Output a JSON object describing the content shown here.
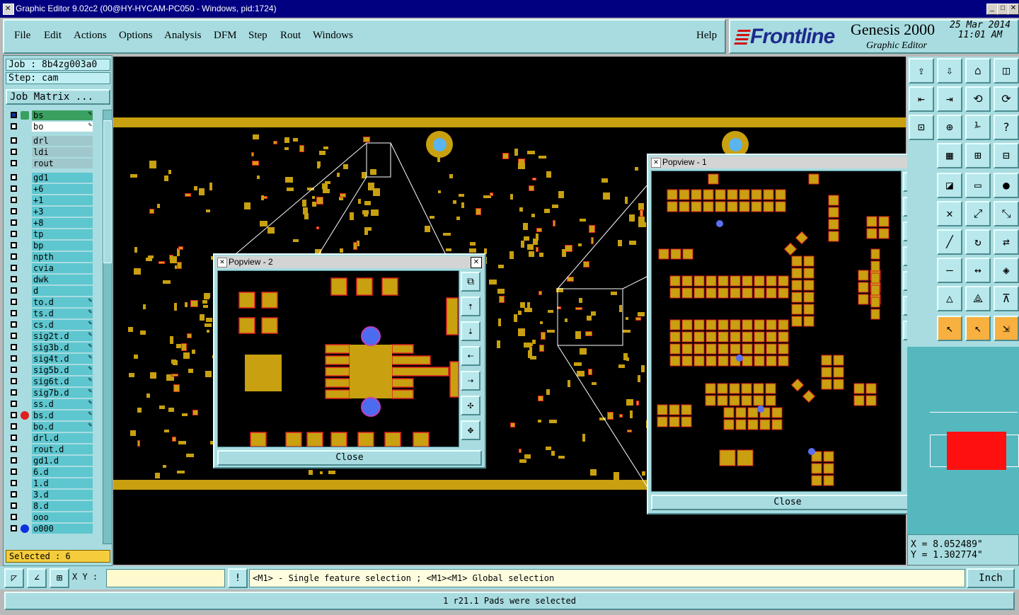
{
  "window": {
    "title": "Graphic Editor 9.02c2 (00@HY-HYCAM-PC050 - Windows, pid:1724)",
    "minimize": "_",
    "maximize": "□",
    "close": "✕"
  },
  "menu": {
    "items": [
      "File",
      "Edit",
      "Actions",
      "Options",
      "Analysis",
      "DFM",
      "Step",
      "Rout",
      "Windows"
    ],
    "help": "Help"
  },
  "brand": {
    "logo": "Frontline",
    "product": "Genesis 2000",
    "subtitle": "Graphic Editor",
    "date": "25 Mar 2014",
    "time": "11:01 AM"
  },
  "left": {
    "job": "Job : 8b4zg003a0",
    "step": "Step: cam",
    "job_matrix": "Job Matrix ...",
    "selected": "Selected : 6",
    "layers": [
      {
        "name": "bs",
        "style": "green",
        "dot": "icon",
        "pen": true
      },
      {
        "name": "bo",
        "style": "white",
        "dot": "",
        "pen": true
      },
      {
        "name": "drl",
        "style": "light",
        "dot": "",
        "pen": false,
        "gap": true
      },
      {
        "name": "ldi",
        "style": "light",
        "dot": "",
        "pen": false
      },
      {
        "name": "rout",
        "style": "light",
        "dot": "",
        "pen": false
      },
      {
        "name": "gd1",
        "style": "",
        "dot": "",
        "pen": false,
        "gap": true
      },
      {
        "name": "+6",
        "style": "",
        "dot": "",
        "pen": false
      },
      {
        "name": "+1",
        "style": "",
        "dot": "",
        "pen": false
      },
      {
        "name": "+3",
        "style": "",
        "dot": "",
        "pen": false
      },
      {
        "name": "+8",
        "style": "",
        "dot": "",
        "pen": false
      },
      {
        "name": "tp",
        "style": "",
        "dot": "",
        "pen": false
      },
      {
        "name": "bp",
        "style": "",
        "dot": "",
        "pen": false
      },
      {
        "name": "npth",
        "style": "",
        "dot": "",
        "pen": false
      },
      {
        "name": "cvia",
        "style": "",
        "dot": "",
        "pen": false
      },
      {
        "name": "dwk",
        "style": "",
        "dot": "",
        "pen": false
      },
      {
        "name": "d",
        "style": "",
        "dot": "",
        "pen": false
      },
      {
        "name": "to.d",
        "style": "",
        "dot": "",
        "pen": true
      },
      {
        "name": "ts.d",
        "style": "",
        "dot": "",
        "pen": true
      },
      {
        "name": "cs.d",
        "style": "",
        "dot": "",
        "pen": true
      },
      {
        "name": "sig2t.d",
        "style": "",
        "dot": "",
        "pen": true
      },
      {
        "name": "sig3b.d",
        "style": "",
        "dot": "",
        "pen": true
      },
      {
        "name": "sig4t.d",
        "style": "",
        "dot": "",
        "pen": true
      },
      {
        "name": "sig5b.d",
        "style": "",
        "dot": "",
        "pen": true
      },
      {
        "name": "sig6t.d",
        "style": "",
        "dot": "",
        "pen": true
      },
      {
        "name": "sig7b.d",
        "style": "",
        "dot": "",
        "pen": true
      },
      {
        "name": "ss.d",
        "style": "",
        "dot": "",
        "pen": true
      },
      {
        "name": "bs.d",
        "style": "",
        "dot": "#e02020",
        "pen": true
      },
      {
        "name": "bo.d",
        "style": "",
        "dot": "",
        "pen": true
      },
      {
        "name": "drl.d",
        "style": "",
        "dot": "",
        "pen": false
      },
      {
        "name": "rout.d",
        "style": "",
        "dot": "",
        "pen": false
      },
      {
        "name": "gd1.d",
        "style": "",
        "dot": "",
        "pen": false
      },
      {
        "name": "6.d",
        "style": "",
        "dot": "",
        "pen": false
      },
      {
        "name": "1.d",
        "style": "",
        "dot": "",
        "pen": false
      },
      {
        "name": "3.d",
        "style": "",
        "dot": "",
        "pen": false
      },
      {
        "name": "8.d",
        "style": "",
        "dot": "",
        "pen": false
      },
      {
        "name": "ooo",
        "style": "",
        "dot": "",
        "pen": false
      },
      {
        "name": "o000",
        "style": "",
        "dot": "#1030e0",
        "pen": false
      }
    ]
  },
  "popview2": {
    "title": "Popview - 2",
    "close": "Close"
  },
  "popview1": {
    "title": "Popview - 1",
    "close": "Close"
  },
  "coords": {
    "x": "X = 8.052489\"",
    "y": "Y = 1.302774\""
  },
  "bottom": {
    "xy_label": "X Y :",
    "xy_value": "",
    "hint": "<M1> - Single feature selection ; <M1><M1> Global selection",
    "unit": "Inch",
    "status": "1 r21.1 Pads were selected"
  },
  "colors": {
    "copper": "#c8a010",
    "panel": "#a8dce0",
    "highlight": "#e02020",
    "via": "#5ab4f0"
  }
}
